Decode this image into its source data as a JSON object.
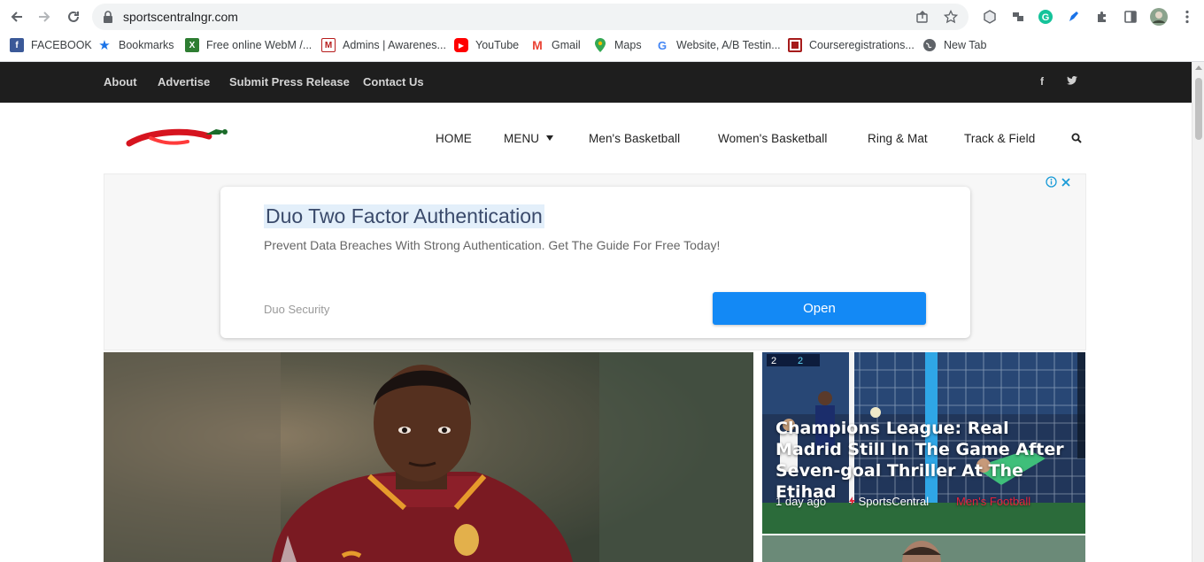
{
  "browser": {
    "url": "sportscentralngr.com"
  },
  "bookmarks": [
    {
      "label": "FACEBOOK",
      "icon": "facebook-icon",
      "color": "#3b5998",
      "glyph": "f"
    },
    {
      "label": "Bookmarks",
      "icon": "star-icon",
      "color": "#1a73e8",
      "glyph": "★"
    },
    {
      "label": "Free online WebM /...",
      "icon": "webm-icon",
      "color": "#2e7d32",
      "glyph": "X"
    },
    {
      "label": "Admins | Awarenes...",
      "icon": "admin-icon",
      "color": "#b71c1c",
      "glyph": "M"
    },
    {
      "label": "YouTube",
      "icon": "youtube-icon",
      "color": "#ff0000",
      "glyph": "▶"
    },
    {
      "label": "Gmail",
      "icon": "gmail-icon",
      "color": "#ea4335",
      "glyph": "M"
    },
    {
      "label": "Maps",
      "icon": "maps-icon",
      "color": "#34a853",
      "glyph": "●"
    },
    {
      "label": "Website, A/B Testin...",
      "icon": "google-icon",
      "color": "#4285f4",
      "glyph": "G"
    },
    {
      "label": "Courseregistrations...",
      "icon": "course-icon",
      "color": "#a61b1b",
      "glyph": "■"
    },
    {
      "label": "New Tab",
      "icon": "globe-icon",
      "color": "#5f6368",
      "glyph": "◍"
    }
  ],
  "site": {
    "top_links": [
      "About",
      "Advertise",
      "Submit Press Release",
      "Contact Us"
    ],
    "social": {
      "facebook": "f",
      "twitter": "t"
    },
    "nav": {
      "home": "HOME",
      "menu": "MENU",
      "mens_basketball": "Men's Basketball",
      "womens_basketball": "Women's Basketball",
      "ring_mat": "Ring & Mat",
      "track_field": "Track & Field"
    }
  },
  "ad": {
    "title": "Duo Two Factor Authentication",
    "description": "Prevent Data Breaches With Strong Authentication. Get The Guide For Free Today!",
    "brand": "Duo Security",
    "cta": "Open"
  },
  "side_article": {
    "title": "Champions League: Real Madrid Still In The Game After Seven-goal Thriller At The Etihad",
    "time": "1 day ago",
    "author": "SportsCentral",
    "category": "Men's Football"
  },
  "colors": {
    "topbar": "#1e1e1e",
    "accent": "#e5243b",
    "ad_button": "#1389f5"
  }
}
